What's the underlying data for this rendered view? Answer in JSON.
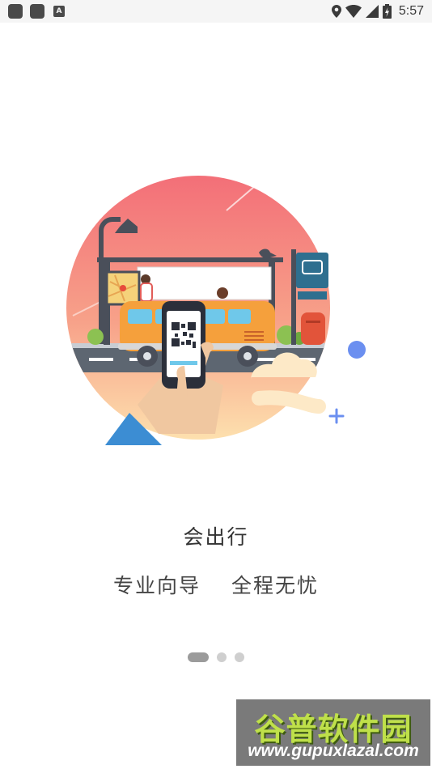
{
  "status_bar": {
    "time": "5:57",
    "app_icons": [
      "app-icon",
      "app-icon",
      "a-icon"
    ],
    "indicators": [
      "location-icon",
      "wifi-icon",
      "signal-icon",
      "battery-icon"
    ],
    "a_label": "A"
  },
  "onboarding": {
    "title": "会出行",
    "subtitle_left": "专业向导",
    "subtitle_right": "全程无忧",
    "page_count": 3,
    "current_page": 1
  },
  "watermark": {
    "title": "谷普软件园",
    "url": "www.gupuxlazal.com"
  },
  "colors": {
    "accent_blue": "#6b8ff0",
    "circle_top": "#f47f7f",
    "circle_bottom": "#fbd3a0",
    "bus_orange": "#f5a03c"
  }
}
